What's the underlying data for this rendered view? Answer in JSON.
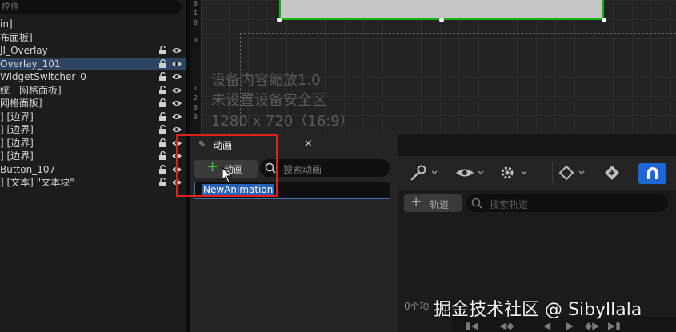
{
  "hierarchy": {
    "search_placeholder": "控件",
    "items": [
      {
        "label": "in]"
      },
      {
        "label": "布面板]"
      },
      {
        "label": "JI_Overlay"
      },
      {
        "label": "Overlay_101"
      },
      {
        "label": "WidgetSwitcher_0"
      },
      {
        "label": "统一网格面板]"
      },
      {
        "label": "网格面板]"
      },
      {
        "label": "] [边界]"
      },
      {
        "label": "] [边界]"
      },
      {
        "label": "] [边界]"
      },
      {
        "label": "] [边界]"
      },
      {
        "label": "Button_107"
      },
      {
        "label": "] [文本] \"文本块\""
      }
    ],
    "selected_index": 3
  },
  "canvas": {
    "ruler_ticks": [
      "0",
      "1",
      "0",
      "0",
      "1",
      "2",
      "0",
      "0"
    ],
    "device_scale_text": "设备内容缩放1.0",
    "safe_zone_text": "未设置设备安全区",
    "resolution_text": "1280 x 720（16:9）"
  },
  "animations_panel": {
    "tab_title": "动画",
    "close_label": "×",
    "add_button_label": "动画",
    "search_placeholder": "搜索动画",
    "new_animation_name": "NewAnimation"
  },
  "sequencer": {
    "track_button_label": "轨道",
    "track_search_placeholder": "搜索轨道",
    "items_count": "0个项"
  },
  "watermark": "掘金技术社区 @ Sibyllala",
  "colors": {
    "selection": "#2f4461",
    "highlight_box": "#e02020",
    "accent_blue": "#1c66d6",
    "widget_outline": "#11b411"
  }
}
